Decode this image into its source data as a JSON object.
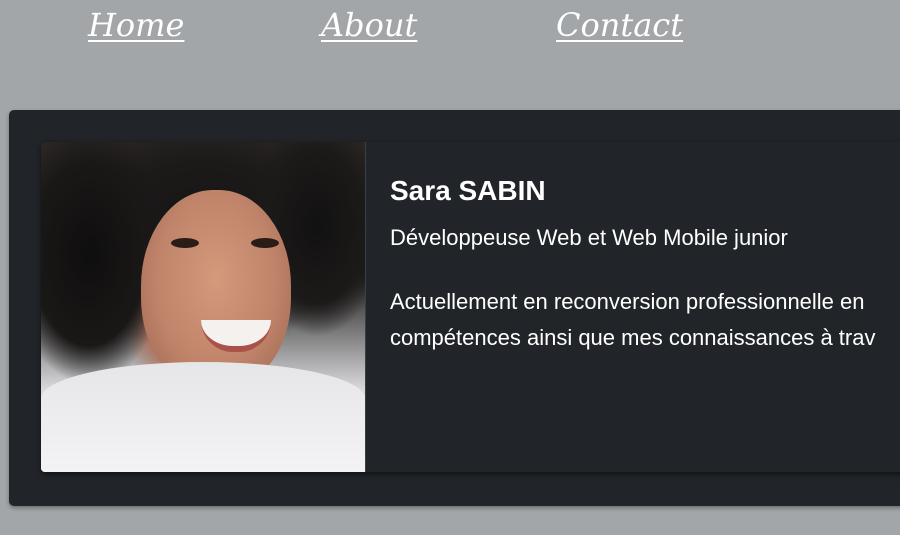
{
  "nav": {
    "home": "Home",
    "about": "About",
    "contact": "Contact"
  },
  "profile": {
    "photo_alt": "Portrait of Sara SABIN",
    "name": "Sara SABIN",
    "role": "Développeuse Web et Web Mobile junior",
    "description_lines": [
      "Actuellement en reconversion professionnelle en",
      "compétences ainsi que mes connaissances à trav"
    ]
  },
  "colors": {
    "page_background": "#a3a6a9",
    "card_background": "#212529",
    "text": "#ffffff"
  }
}
